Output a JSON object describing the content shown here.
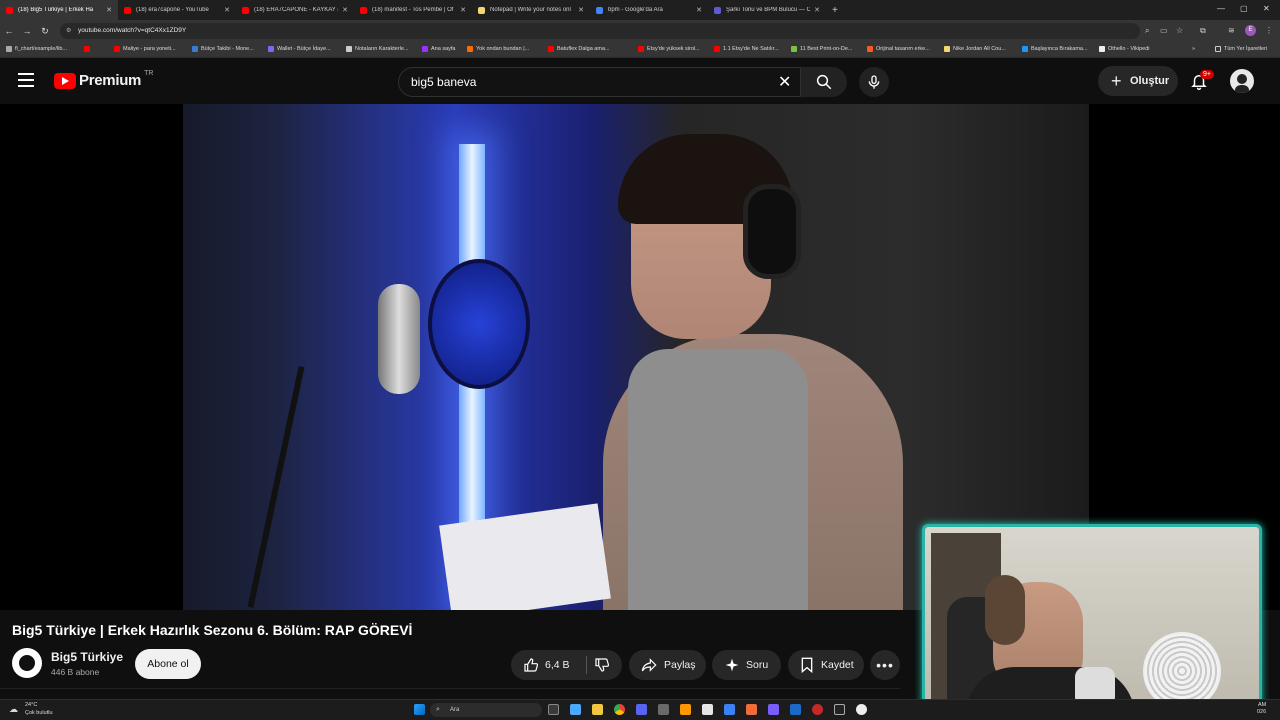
{
  "browser": {
    "tabs": [
      {
        "title": "(18) Big5 Türkiye | Erkek Ha",
        "color": "#ff0000",
        "active": true
      },
      {
        "title": "(18) era7capone - YouTube",
        "color": "#ff0000",
        "active": false
      },
      {
        "title": "(18) ERA7CAPONE - KAYKAY (C",
        "color": "#ff0000",
        "active": false
      },
      {
        "title": "(18) manifest - Tos Pembe | Of",
        "color": "#ff0000",
        "active": false
      },
      {
        "title": "Notepad | Write your notes onl",
        "color": "#f5d76e",
        "active": false
      },
      {
        "title": "bpm - Google'da Ara",
        "color": "#4285f4",
        "active": false
      },
      {
        "title": "Şarkı Tonu ve BPM Bulucu — C",
        "color": "#5b5bd6",
        "active": false
      }
    ],
    "new_tab": "+",
    "window_controls": [
      "—",
      "▢",
      "✕"
    ],
    "url": "youtube.com/watch?v=qtC4Xx1ZD9Y",
    "profile_initial": "E",
    "bookmarks": [
      {
        "label": "fl_chart/example/lib...",
        "color": "#aaaaaa"
      },
      {
        "label": "",
        "color": "#ff0000"
      },
      {
        "label": "Maliye - para yoneti...",
        "color": "#ff0000"
      },
      {
        "label": "Bütçe Takibi - Mone...",
        "color": "#3a7bd5"
      },
      {
        "label": "Wallet - Bütçe İdaye...",
        "color": "#7b68ee"
      },
      {
        "label": "Notaların Karakterle...",
        "color": "#cccccc"
      },
      {
        "label": "Ana sayfa",
        "color": "#9b30ff"
      },
      {
        "label": "Yok ondan bundan |...",
        "color": "#ff6a00"
      },
      {
        "label": "Batuflex Dalga ama...",
        "color": "#ff0000"
      },
      {
        "label": "Etsy'de yüksek sirol...",
        "color": "#ff0000"
      },
      {
        "label": "1.1 Etsy'de Ne Satılır...",
        "color": "#ff0000"
      },
      {
        "label": "11 Best Print-on-De...",
        "color": "#7cc242"
      },
      {
        "label": "Orijinal tasarım erke...",
        "color": "#ff5722"
      },
      {
        "label": "Nike Jordan All Cou...",
        "color": "#f5d76e"
      },
      {
        "label": "Başlayınca Bırakama...",
        "color": "#2196f3"
      },
      {
        "label": "Othello - Vikipedi",
        "color": "#eeeeee"
      }
    ],
    "bookmarks_more": "»",
    "all_bookmarks": "Tüm Yer İşaretleri"
  },
  "youtube": {
    "logo_text": "Premium",
    "region": "TR",
    "search_value": "big5 baneva",
    "create_label": "Oluştur",
    "notifications_badge": "9+",
    "video": {
      "title": "Big5 Türkiye | Erkek Hazırlık Sezonu 6. Bölüm: RAP GÖREVİ",
      "channel_name": "Big5 Türkiye",
      "subscribers": "446 B abone",
      "subscribe_label": "Abone ol",
      "likes": "6,4 B",
      "share_label": "Paylaş",
      "ask_label": "Soru",
      "save_label": "Kaydet",
      "more_label": "•••"
    }
  },
  "taskbar": {
    "weather_temp": "24°C",
    "weather_desc": "Çok bulutlu",
    "search_placeholder": "Ara",
    "time": "AM",
    "date": "026"
  },
  "colors": {
    "yt_red": "#ff0000",
    "webcam_border": "#29b4a8",
    "badge_red": "#cc0000"
  }
}
